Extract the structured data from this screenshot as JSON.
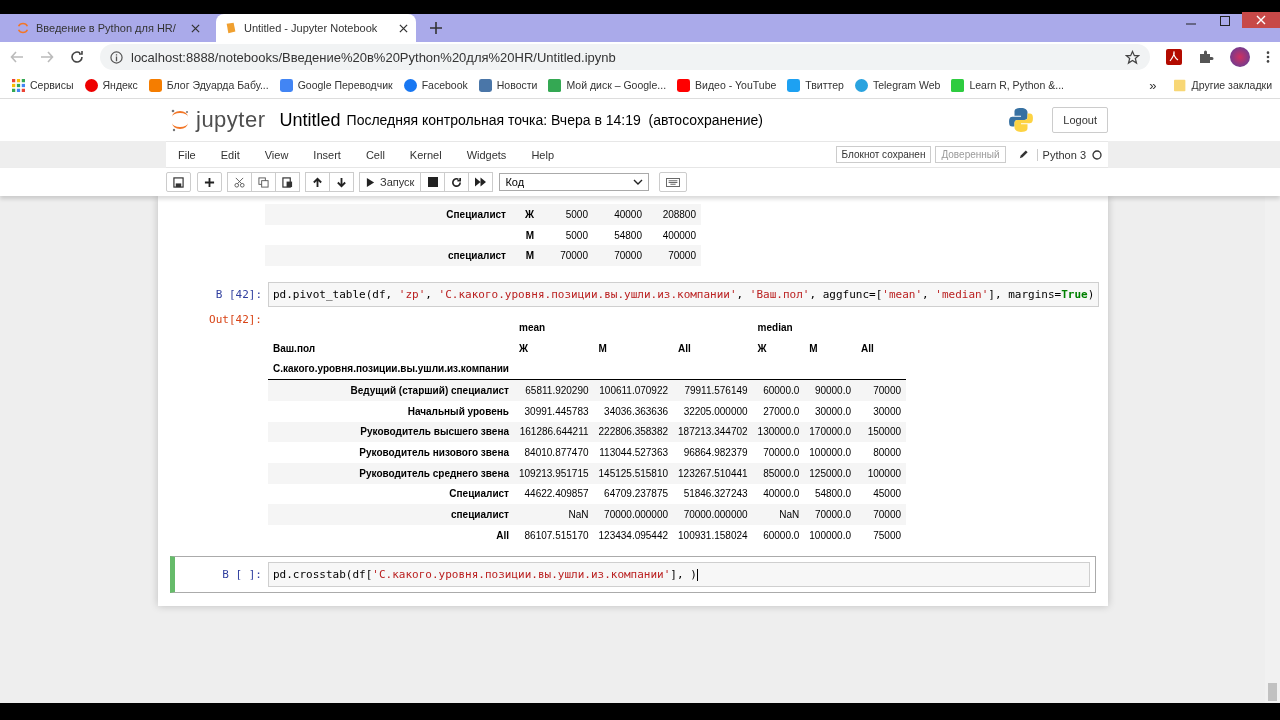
{
  "browser": {
    "tabs": [
      {
        "title": "Введение в Python для HR/",
        "selected": false
      },
      {
        "title": "Untitled - Jupyter Notebook",
        "selected": true
      }
    ],
    "url": "localhost:8888/notebooks/Введение%20в%20Python%20для%20HR/Untitled.ipynb",
    "bookmarks": [
      {
        "label": "Сервисы"
      },
      {
        "label": "Яндекс"
      },
      {
        "label": "Блог Эдуарда Бабу..."
      },
      {
        "label": "Google Переводчик"
      },
      {
        "label": "Facebook"
      },
      {
        "label": "Новости"
      },
      {
        "label": "Мой диск – Google..."
      },
      {
        "label": "Видео - YouTube"
      },
      {
        "label": "Твиттер"
      },
      {
        "label": "Telegram Web"
      },
      {
        "label": "Learn R, Python &..."
      }
    ],
    "more_bookmarks": "»",
    "other_bookmarks": "Другие закладки"
  },
  "header": {
    "logo_text": "jupyter",
    "title": "Untitled",
    "checkpoint": "Последняя контрольная точка: Вчера в 14:19  (автосохранение)",
    "logout": "Logout"
  },
  "menu": [
    "File",
    "Edit",
    "View",
    "Insert",
    "Cell",
    "Kernel",
    "Widgets",
    "Help"
  ],
  "status": {
    "saved": "Блокнот сохранен",
    "trusted": "Доверенный",
    "kernel": "Python 3"
  },
  "toolbar": {
    "run": "Запуск",
    "cell_type": "Код"
  },
  "prev_output": {
    "rows": [
      {
        "index": "Специалист",
        "sex": "Ж",
        "values": [
          "5000",
          "40000",
          "208800"
        ]
      },
      {
        "index": "",
        "sex": "М",
        "values": [
          "5000",
          "54800",
          "400000"
        ]
      },
      {
        "index": "специалист",
        "sex": "М",
        "values": [
          "70000",
          "70000",
          "70000"
        ]
      }
    ]
  },
  "cells": [
    {
      "prompt": "В [42]:",
      "selected": false,
      "code": [
        {
          "kind": "plain",
          "text": "pd.pivot_table(df, "
        },
        {
          "kind": "string",
          "text": "'zp'"
        },
        {
          "kind": "plain",
          "text": ", "
        },
        {
          "kind": "string",
          "text": "'С.какого.уровня.позиции.вы.ушли.из.компании'"
        },
        {
          "kind": "plain",
          "text": ", "
        },
        {
          "kind": "string",
          "text": "'Ваш.пол'"
        },
        {
          "kind": "plain",
          "text": ", aggfunc=["
        },
        {
          "kind": "string",
          "text": "'mean'"
        },
        {
          "kind": "plain",
          "text": ", "
        },
        {
          "kind": "string",
          "text": "'median'"
        },
        {
          "kind": "plain",
          "text": "], margins="
        },
        {
          "kind": "keyword",
          "text": "True"
        },
        {
          "kind": "plain",
          "text": ")"
        }
      ],
      "output": {
        "prompt": "Out[42]:",
        "groups": [
          "mean",
          "median"
        ],
        "column_name": "Ваш.пол",
        "columns": [
          "Ж",
          "М",
          "All",
          "Ж",
          "М",
          "All"
        ],
        "index_name": "С.какого.уровня.позиции.вы.ушли.из.компании",
        "rows": [
          {
            "index": "Ведущий (старший) специалист",
            "values": [
              "65811.920290",
              "100611.070922",
              "79911.576149",
              "60000.0",
              "90000.0",
              "70000"
            ]
          },
          {
            "index": "Начальный уровень",
            "values": [
              "30991.445783",
              "34036.363636",
              "32205.000000",
              "27000.0",
              "30000.0",
              "30000"
            ]
          },
          {
            "index": "Руководитель высшего звена",
            "values": [
              "161286.644211",
              "222806.358382",
              "187213.344702",
              "130000.0",
              "170000.0",
              "150000"
            ]
          },
          {
            "index": "Руководитель низового звена",
            "values": [
              "84010.877470",
              "113044.527363",
              "96864.982379",
              "70000.0",
              "100000.0",
              "80000"
            ]
          },
          {
            "index": "Руководитель среднего звена",
            "values": [
              "109213.951715",
              "145125.515810",
              "123267.510441",
              "85000.0",
              "125000.0",
              "100000"
            ]
          },
          {
            "index": "Специалист",
            "values": [
              "44622.409857",
              "64709.237875",
              "51846.327243",
              "40000.0",
              "54800.0",
              "45000"
            ]
          },
          {
            "index": "специалист",
            "values": [
              "NaN",
              "70000.000000",
              "70000.000000",
              "NaN",
              "70000.0",
              "70000"
            ]
          },
          {
            "index": "All",
            "values": [
              "86107.515170",
              "123434.095442",
              "100931.158024",
              "60000.0",
              "100000.0",
              "75000"
            ]
          }
        ]
      }
    },
    {
      "prompt": "В [ ]:",
      "selected": true,
      "code": [
        {
          "kind": "plain",
          "text": "pd.crosstab(df["
        },
        {
          "kind": "string",
          "text": "'С.какого.уровня.позиции.вы.ушли.из.компании'"
        },
        {
          "kind": "plain",
          "text": "], )"
        }
      ]
    }
  ]
}
